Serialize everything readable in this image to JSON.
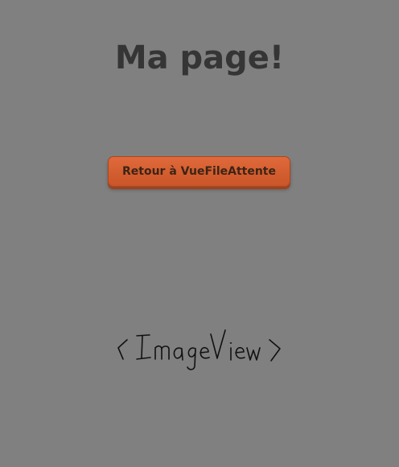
{
  "page": {
    "title": "Ma page!",
    "background_color": "#808080"
  },
  "actions": {
    "back_button_label": "Retour à VueFileAttente",
    "back_button_color": "#d35e2f"
  },
  "image_view": {
    "placeholder_text": "<ImageView>"
  }
}
